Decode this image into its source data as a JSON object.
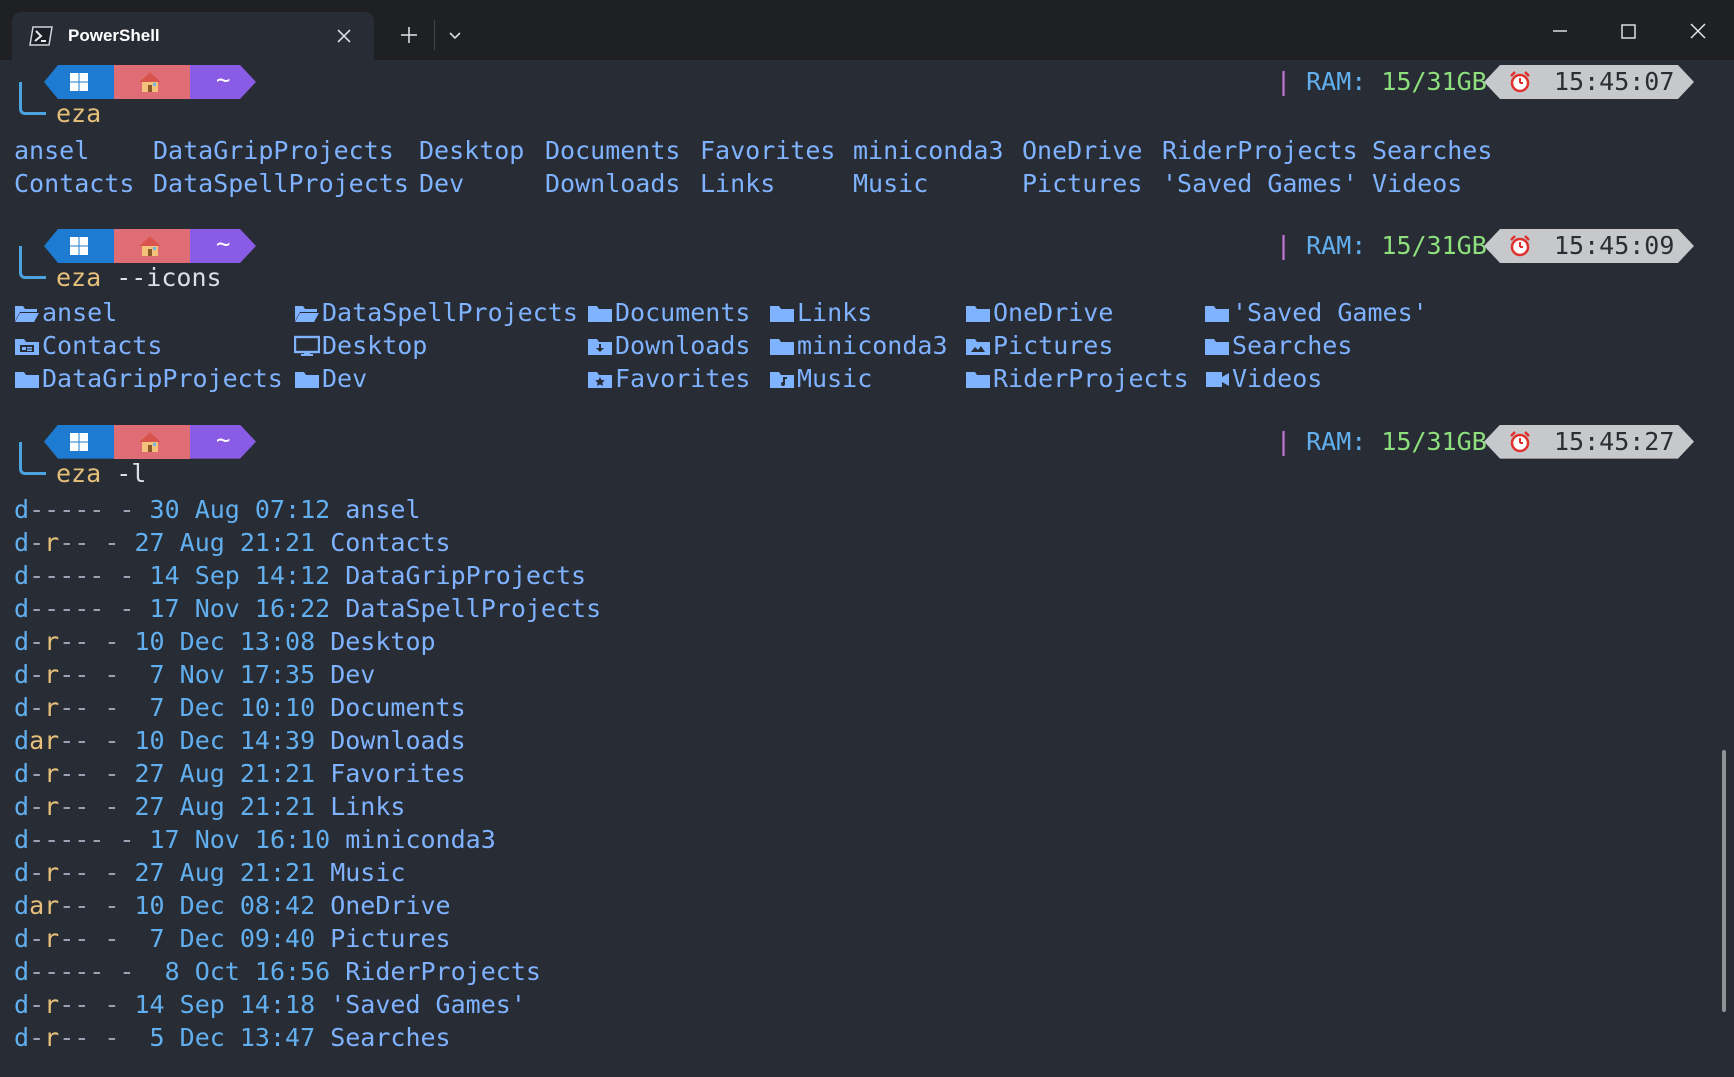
{
  "window": {
    "tab_title": "PowerShell"
  },
  "prompts": [
    {
      "command_prefix": "eza",
      "command_args": "",
      "ram_label": "RAM:",
      "ram_value": "15/31GB",
      "time": "15:45:07",
      "tilde": "~"
    },
    {
      "command_prefix": "eza",
      "command_args": " --icons",
      "ram_label": "RAM:",
      "ram_value": "15/31GB",
      "time": "15:45:09",
      "tilde": "~"
    },
    {
      "command_prefix": "eza",
      "command_args": " -l",
      "ram_label": "RAM:",
      "ram_value": "15/31GB",
      "time": "15:45:27",
      "tilde": "~"
    }
  ],
  "grid_output": {
    "rows": [
      [
        "ansel",
        "DataGripProjects",
        "Desktop",
        "Documents",
        "Favorites",
        "miniconda3",
        "OneDrive",
        "RiderProjects",
        "Searches"
      ],
      [
        "Contacts",
        "DataSpellProjects",
        "Dev",
        "Downloads",
        "Links",
        "Music",
        "Pictures",
        "'Saved Games'",
        "Videos"
      ]
    ]
  },
  "icons_output": {
    "rows": [
      [
        {
          "icon": "folder-open-icon",
          "name": "ansel"
        },
        {
          "icon": "folder-open-icon",
          "name": "DataSpellProjects"
        },
        {
          "icon": "folder-icon",
          "name": "Documents"
        },
        {
          "icon": "folder-icon",
          "name": "Links"
        },
        {
          "icon": "folder-icon",
          "name": "OneDrive"
        },
        {
          "icon": "folder-icon",
          "name": "'Saved Games'"
        }
      ],
      [
        {
          "icon": "contacts-folder-icon",
          "name": "Contacts"
        },
        {
          "icon": "desktop-icon",
          "name": "Desktop"
        },
        {
          "icon": "downloads-folder-icon",
          "name": "Downloads"
        },
        {
          "icon": "folder-icon",
          "name": "miniconda3"
        },
        {
          "icon": "pictures-folder-icon",
          "name": "Pictures"
        },
        {
          "icon": "folder-icon",
          "name": "Searches"
        }
      ],
      [
        {
          "icon": "folder-icon",
          "name": "DataGripProjects"
        },
        {
          "icon": "folder-icon",
          "name": "Dev"
        },
        {
          "icon": "favorites-folder-icon",
          "name": "Favorites"
        },
        {
          "icon": "music-folder-icon",
          "name": "Music"
        },
        {
          "icon": "folder-icon",
          "name": "RiderProjects"
        },
        {
          "icon": "videos-folder-icon",
          "name": "Videos"
        }
      ]
    ]
  },
  "long_output": [
    {
      "perm_d": "d",
      "perm_a": "-",
      "perm_r": "-",
      "perm_rest": "---",
      "size": "-",
      "day": "30",
      "month": "Aug",
      "time": "07:12",
      "name": "ansel"
    },
    {
      "perm_d": "d",
      "perm_a": "-",
      "perm_r": "r",
      "perm_rest": "--",
      "size": "-",
      "day": "27",
      "month": "Aug",
      "time": "21:21",
      "name": "Contacts"
    },
    {
      "perm_d": "d",
      "perm_a": "-",
      "perm_r": "-",
      "perm_rest": "---",
      "size": "-",
      "day": "14",
      "month": "Sep",
      "time": "14:12",
      "name": "DataGripProjects"
    },
    {
      "perm_d": "d",
      "perm_a": "-",
      "perm_r": "-",
      "perm_rest": "---",
      "size": "-",
      "day": "17",
      "month": "Nov",
      "time": "16:22",
      "name": "DataSpellProjects"
    },
    {
      "perm_d": "d",
      "perm_a": "-",
      "perm_r": "r",
      "perm_rest": "--",
      "size": "-",
      "day": "10",
      "month": "Dec",
      "time": "13:08",
      "name": "Desktop"
    },
    {
      "perm_d": "d",
      "perm_a": "-",
      "perm_r": "r",
      "perm_rest": "--",
      "size": "-",
      "day": " 7",
      "month": "Nov",
      "time": "17:35",
      "name": "Dev"
    },
    {
      "perm_d": "d",
      "perm_a": "-",
      "perm_r": "r",
      "perm_rest": "--",
      "size": "-",
      "day": " 7",
      "month": "Dec",
      "time": "10:10",
      "name": "Documents"
    },
    {
      "perm_d": "d",
      "perm_a": "a",
      "perm_r": "r",
      "perm_rest": "--",
      "size": "-",
      "day": "10",
      "month": "Dec",
      "time": "14:39",
      "name": "Downloads"
    },
    {
      "perm_d": "d",
      "perm_a": "-",
      "perm_r": "r",
      "perm_rest": "--",
      "size": "-",
      "day": "27",
      "month": "Aug",
      "time": "21:21",
      "name": "Favorites"
    },
    {
      "perm_d": "d",
      "perm_a": "-",
      "perm_r": "r",
      "perm_rest": "--",
      "size": "-",
      "day": "27",
      "month": "Aug",
      "time": "21:21",
      "name": "Links"
    },
    {
      "perm_d": "d",
      "perm_a": "-",
      "perm_r": "-",
      "perm_rest": "---",
      "size": "-",
      "day": "17",
      "month": "Nov",
      "time": "16:10",
      "name": "miniconda3"
    },
    {
      "perm_d": "d",
      "perm_a": "-",
      "perm_r": "r",
      "perm_rest": "--",
      "size": "-",
      "day": "27",
      "month": "Aug",
      "time": "21:21",
      "name": "Music"
    },
    {
      "perm_d": "d",
      "perm_a": "a",
      "perm_r": "r",
      "perm_rest": "--",
      "size": "-",
      "day": "10",
      "month": "Dec",
      "time": "08:42",
      "name": "OneDrive"
    },
    {
      "perm_d": "d",
      "perm_a": "-",
      "perm_r": "r",
      "perm_rest": "--",
      "size": "-",
      "day": " 7",
      "month": "Dec",
      "time": "09:40",
      "name": "Pictures"
    },
    {
      "perm_d": "d",
      "perm_a": "-",
      "perm_r": "-",
      "perm_rest": "---",
      "size": "-",
      "day": " 8",
      "month": "Oct",
      "time": "16:56",
      "name": "RiderProjects"
    },
    {
      "perm_d": "d",
      "perm_a": "-",
      "perm_r": "r",
      "perm_rest": "--",
      "size": "-",
      "day": "14",
      "month": "Sep",
      "time": "14:18",
      "name": "'Saved Games'"
    },
    {
      "perm_d": "d",
      "perm_a": "-",
      "perm_r": "r",
      "perm_rest": "--",
      "size": "-",
      "day": " 5",
      "month": "Dec",
      "time": "13:47",
      "name": "Searches"
    }
  ],
  "colors": {
    "background": "#282c34",
    "titlebar": "#1f2023",
    "dir_blue": "#7fb2ff",
    "ram_green": "#8ee07d",
    "prompt_yellow": "#e6c07b",
    "seg_windows": "#1d7bd1",
    "seg_home": "#e06c75",
    "seg_tilde": "#8a5ce6"
  }
}
